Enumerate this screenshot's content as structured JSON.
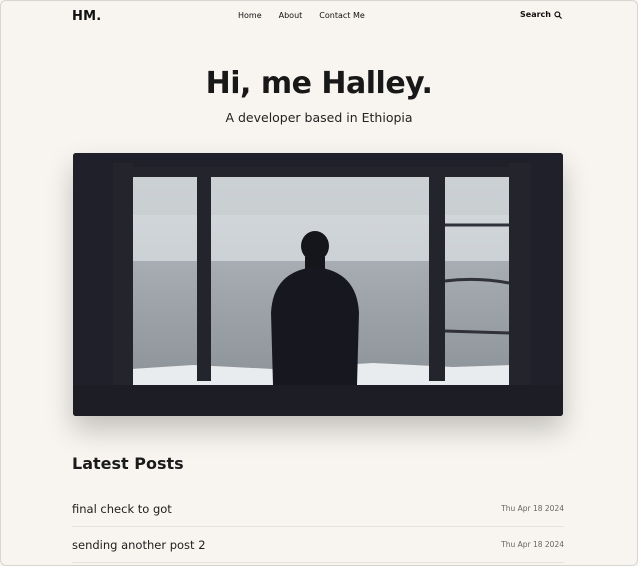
{
  "header": {
    "logo": "HM.",
    "nav": [
      "Home",
      "About",
      "Contact Me"
    ],
    "search_label": "Search"
  },
  "hero": {
    "title": "Hi, me Halley.",
    "subtitle": "A developer based in Ethiopia"
  },
  "posts": {
    "heading": "Latest Posts",
    "items": [
      {
        "title": "final check to got",
        "date": "Thu Apr 18 2024"
      },
      {
        "title": "sending another post 2",
        "date": "Thu Apr 18 2024"
      }
    ]
  },
  "colors": {
    "background": "#f8f5f0",
    "text": "#1b1b1b",
    "image_frame": "#1d1e26"
  },
  "icons": {
    "search": "search-icon"
  }
}
